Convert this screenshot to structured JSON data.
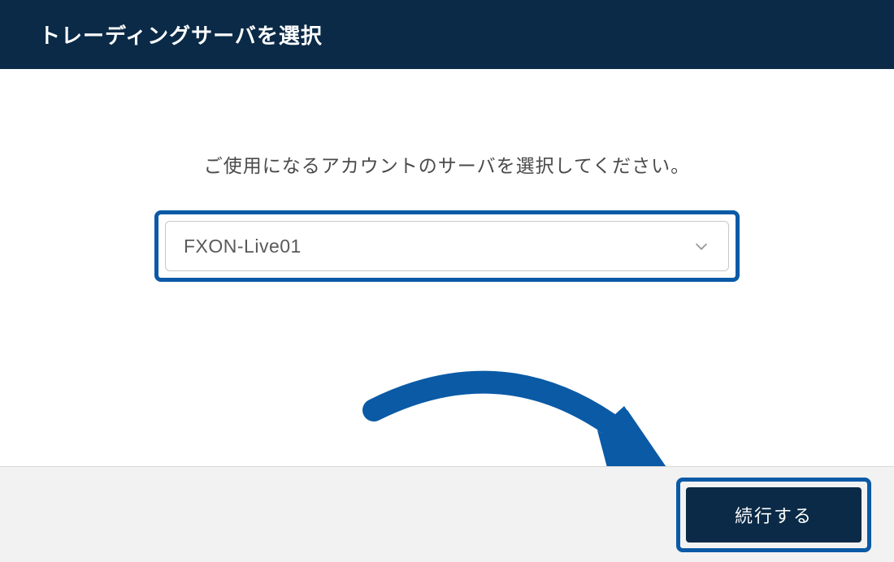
{
  "header": {
    "title": "トレーディングサーバを選択"
  },
  "content": {
    "instruction": "ご使用になるアカウントのサーバを選択してください。",
    "dropdown": {
      "selected": "FXON-Live01"
    }
  },
  "footer": {
    "continue_label": "続行する"
  },
  "colors": {
    "header_bg": "#0a2a47",
    "highlight_border": "#0a5aa6",
    "arrow_fill": "#0a5aa6"
  }
}
